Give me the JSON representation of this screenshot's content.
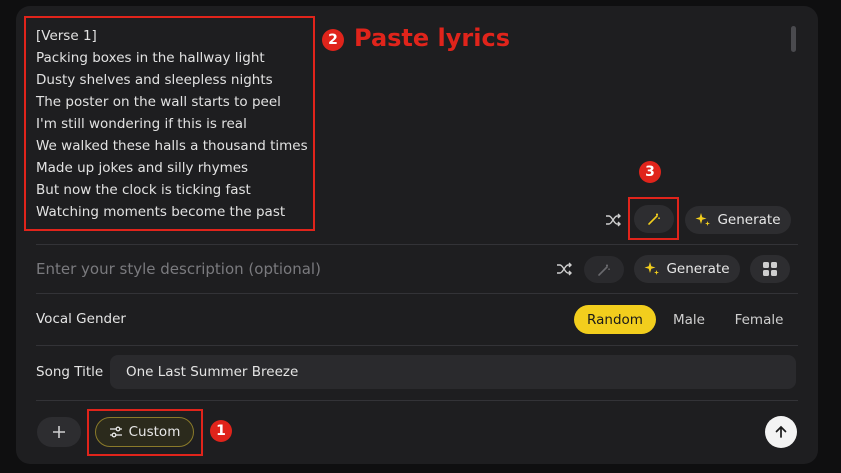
{
  "lyrics": {
    "lines": [
      "[Verse 1]",
      "Packing boxes in the hallway light",
      "Dusty shelves and sleepless nights",
      "The poster on the wall starts to peel",
      "I'm still wondering if this is real",
      "We walked these halls a thousand times",
      "Made up jokes and silly rhymes",
      "But now the clock is ticking fast",
      "Watching moments become the past"
    ]
  },
  "annotations": {
    "badge1": "1",
    "badge2": "2",
    "badge3": "3",
    "paste_label": "Paste lyrics",
    "color": "#e0241b"
  },
  "lyrics_toolbar": {
    "shuffle_icon": "shuffle-icon",
    "magic_icon": "magic-wand-icon",
    "generate_label": "Generate"
  },
  "style": {
    "placeholder": "Enter your style description (optional)",
    "generate_label": "Generate",
    "grid_icon": "grid-icon"
  },
  "vocal": {
    "label": "Vocal Gender",
    "options": [
      "Random",
      "Male",
      "Female"
    ],
    "selected": "Random",
    "accent": "#f2ce1d"
  },
  "song_title": {
    "label": "Song Title",
    "value": "One Last Summer Breeze"
  },
  "bottom": {
    "custom_label": "Custom",
    "add_icon": "plus-icon",
    "submit_icon": "arrow-up-icon"
  }
}
